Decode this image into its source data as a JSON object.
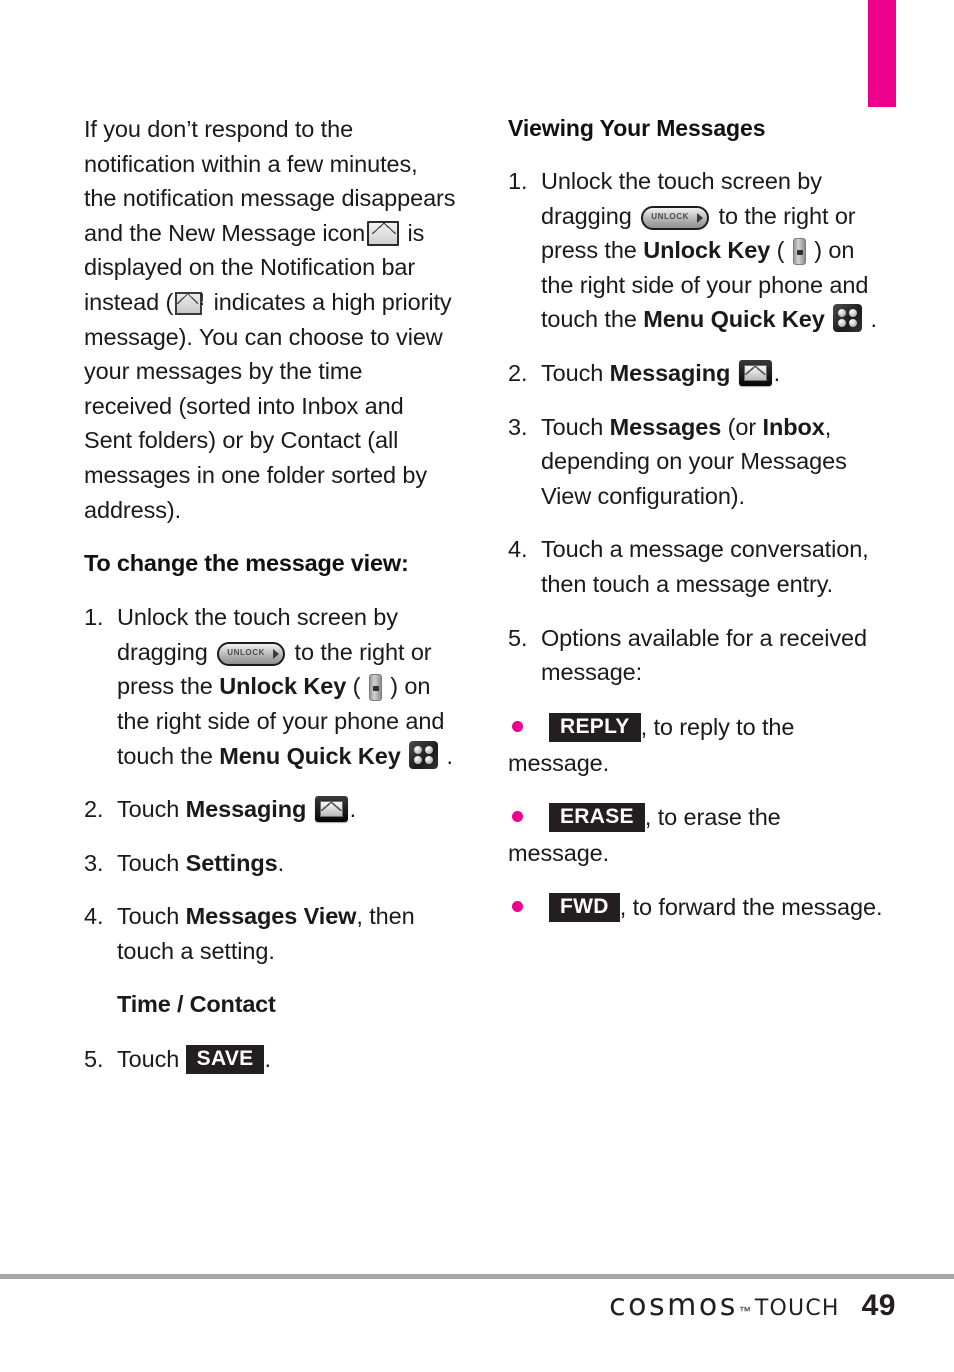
{
  "page": {
    "number": "49",
    "brand": "cosmos",
    "brand_tm": "™",
    "brand_sub": "TOUCH"
  },
  "tab_marker_color": "#ec008c",
  "bullet_color": "#ec008c",
  "left_column": {
    "intro_paragraph_part1": "If you don’t respond to the notification within a few minutes, the notification message disappears and the New Message icon",
    "intro_paragraph_part2": "is displayed on the Notification bar instead (",
    "intro_paragraph_part3": "indicates a high priority message). You can choose to view your messages by the time received (sorted into Inbox and Sent folders) or by Contact (all messages in one folder sorted by address).",
    "subheading": "To change the message view:",
    "steps": [
      {
        "num": "1.",
        "t1": "Unlock the touch screen by dragging",
        "t2": "to the right or press the",
        "bold1": "Unlock Key",
        "t3": "(",
        "t4": ") on the right side of your phone and touch the",
        "bold2": "Menu Quick Key",
        "t5": "."
      },
      {
        "num": "2.",
        "t1": "Touch",
        "bold1": "Messaging",
        "t2": "."
      },
      {
        "num": "3.",
        "t1": "Touch",
        "bold1": "Settings",
        "t2": "."
      },
      {
        "num": "4.",
        "t1": "Touch",
        "bold1": "Messages View",
        "t2": ", then touch a setting."
      },
      {
        "num": "5.",
        "t1": "Touch",
        "keycap": "SAVE",
        "t2": "."
      }
    ],
    "setting_values": "Time / Contact"
  },
  "right_column": {
    "heading": "Viewing Your Messages",
    "steps": [
      {
        "num": "1.",
        "t1": "Unlock the touch screen by dragging",
        "t2": "to the right or press the",
        "bold1": "Unlock Key",
        "t3": "(",
        "t4": ") on the right side of your phone and touch the",
        "bold2": "Menu Quick Key",
        "t5": "."
      },
      {
        "num": "2.",
        "t1": "Touch",
        "bold1": "Messaging",
        "t2": "."
      },
      {
        "num": "3.",
        "t1": "Touch",
        "bold1": "Messages",
        "t2": "(or",
        "bold2": "Inbox",
        "t3": ", depending on your Messages View configuration)."
      },
      {
        "num": "4.",
        "t1": "Touch a message conversation, then touch a message entry."
      },
      {
        "num": "5.",
        "t1": "Options available for a received message:"
      }
    ],
    "options": [
      {
        "keycap": "REPLY",
        "text": ", to reply to the message."
      },
      {
        "keycap": "ERASE",
        "text": ", to erase the message."
      },
      {
        "keycap": "FWD",
        "text": ", to forward the message."
      }
    ]
  },
  "icons": {
    "unlock_slider_label": "UNLOCK",
    "priority_bang": "!"
  }
}
